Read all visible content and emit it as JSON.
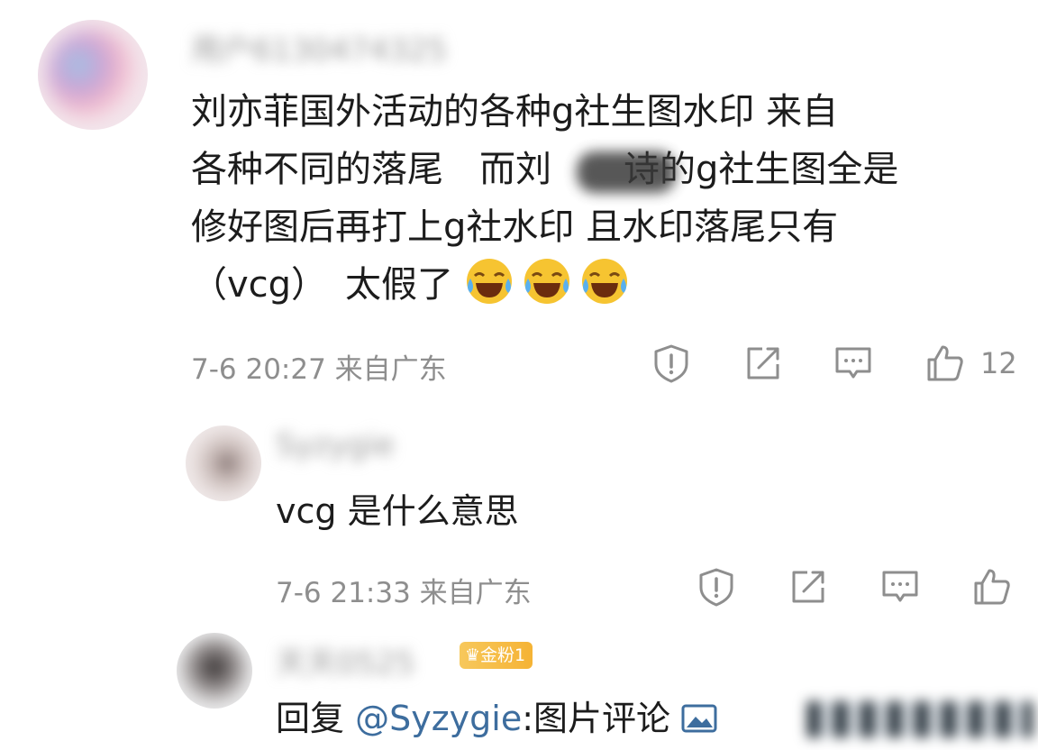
{
  "comment": {
    "username": "用户6130474325",
    "text_lines": [
      "刘亦菲国外活动的各种g社生图水印 来自",
      "各种不同的落尾　而刘　　诗的g社生图全是",
      "修好图后再打上g社水印 且水印落尾只有",
      "（vcg）　太假了"
    ],
    "emoji_name": "laugh-cry-emoji",
    "emoji_count": 3,
    "time": "7-6 20:27 来自广东",
    "like_count": "12"
  },
  "reply1": {
    "username": "Syzygie",
    "text": "vcg 是什么意思",
    "time": "7-6 21:33 来自广东"
  },
  "reply2": {
    "username": "天天0525",
    "badge": "金粉1",
    "reply_prefix": "回复 ",
    "mention": "@Syzygie",
    "reply_text": ":图片评论"
  },
  "icons": [
    "report-icon",
    "share-icon",
    "comment-icon",
    "like-icon",
    "crown-icon",
    "image-icon"
  ],
  "colors": {
    "meta_gray": "#8e8e8e",
    "link_blue": "#3d6d9e",
    "badge_gold": "#f5b335"
  }
}
